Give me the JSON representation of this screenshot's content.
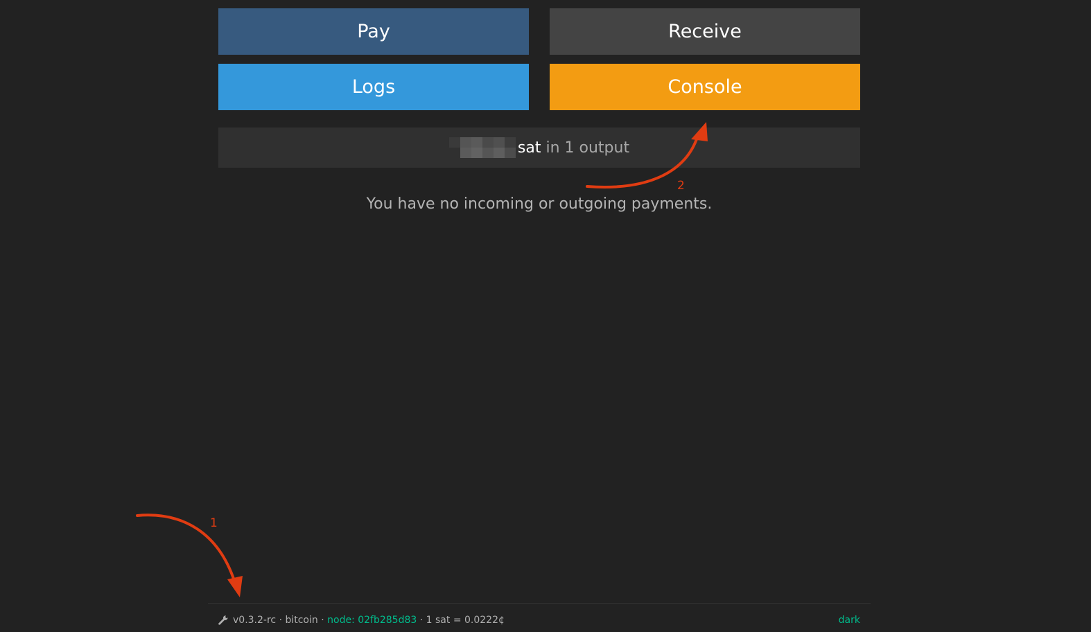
{
  "actions": {
    "pay_label": "Pay",
    "receive_label": "Receive",
    "logs_label": "Logs",
    "console_label": "Console"
  },
  "balance": {
    "unit": "sat",
    "outputs_text": "in 1 output"
  },
  "payments": {
    "empty_message": "You have no incoming or outgoing payments."
  },
  "footer": {
    "version": "v0.3.2-rc",
    "network": "bitcoin",
    "node": "node: 02fb285d83",
    "rate": "1 sat = 0.0222¢",
    "separator": "·",
    "theme_toggle": "dark"
  },
  "annotations": {
    "label_1": "1",
    "label_2": "2"
  },
  "colors": {
    "background": "#222222",
    "pay": "#375a7f",
    "receive": "#444444",
    "logs": "#3498db",
    "console": "#f39c12",
    "accent_green": "#00bc8c",
    "annotation_red": "#e03c12"
  }
}
